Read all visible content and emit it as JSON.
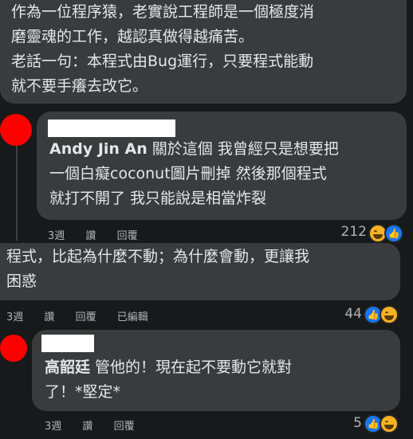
{
  "comment_top": {
    "text": "作為一位程序猿，老實說工程師是一個極度消\n磨靈魂的工作，越認真做得越痛苦。\n老話一句：本程式由Bug運行，只要程式能動\n就不要手癢去改它。"
  },
  "reply_andy": {
    "author": "Andy Jin An",
    "text": "關於這個 我曾經只是想要把\n一個白癡coconut圖片刪掉 然後那個程式\n就打不開了 我只能說是相當炸裂",
    "time": "3週",
    "like_label": "讚",
    "reply_label": "回覆",
    "reaction_count": "212",
    "reactions": [
      "haha-icon",
      "like-icon"
    ]
  },
  "comment_mid": {
    "text": "程式，比起為什麼不動；為什麼會動，更讓我\n困惑",
    "time": "3週",
    "like_label": "讚",
    "reply_label": "回覆",
    "edited_label": "已編輯",
    "reaction_count": "44",
    "reactions": [
      "like-icon",
      "haha-icon"
    ]
  },
  "reply_gao": {
    "author": "高韶廷",
    "text": "管他的！現在起不要動它就對\n了！*堅定*",
    "time": "3週",
    "like_label": "讚",
    "reply_label": "回覆",
    "reaction_count": "5",
    "reactions": [
      "like-icon",
      "haha-icon"
    ]
  },
  "colors": {
    "background": "#18191a",
    "bubble": "#3a3b3c",
    "text": "#e4e6eb",
    "meta": "#b0b3b8",
    "avatar": "#ff0000",
    "like_blue": "#1877f2",
    "haha_yellow": "#f7b125"
  }
}
